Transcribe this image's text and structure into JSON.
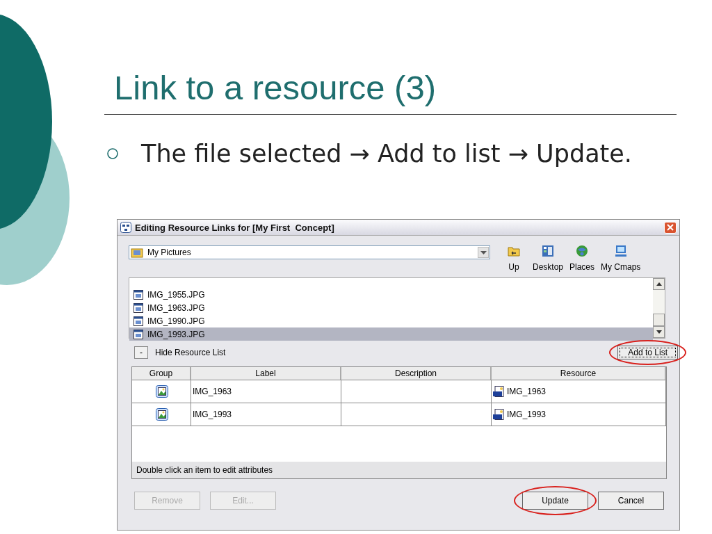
{
  "slide": {
    "title": "Link to a resource (3)",
    "bullets": [
      {
        "text": "The file selected → Add to list → Update."
      }
    ]
  },
  "dialog": {
    "title": "Editing Resource Links for [My First  Concept]",
    "location": {
      "value": "My Pictures"
    },
    "nav_buttons": [
      {
        "label": "Up",
        "kind": "up"
      },
      {
        "label": "Desktop",
        "kind": "desktop"
      },
      {
        "label": "Places",
        "kind": "places"
      },
      {
        "label": "My Cmaps",
        "kind": "cmaps"
      }
    ],
    "files": [
      {
        "name": "IMG_1955.JPG",
        "selected": false
      },
      {
        "name": "IMG_1963.JPG",
        "selected": false
      },
      {
        "name": "IMG_1990.JPG",
        "selected": false
      },
      {
        "name": "IMG_1993.JPG",
        "selected": true
      }
    ],
    "toggle": {
      "symbol": "-",
      "label": "Hide Resource List"
    },
    "add_button": {
      "label": "Add to List",
      "focused": true,
      "circled": true
    },
    "table": {
      "columns": [
        "Group",
        "Label",
        "Description",
        "Resource"
      ],
      "rows": [
        {
          "label": "IMG_1963",
          "resource": "IMG_1963"
        },
        {
          "label": "IMG_1993",
          "resource": "IMG_1993"
        }
      ]
    },
    "hint": "Double click an item to edit attributes",
    "buttons": [
      {
        "label": "Remove",
        "disabled": true,
        "circled": false
      },
      {
        "label": "Edit...",
        "disabled": true,
        "circled": false
      },
      {
        "label": "Update",
        "disabled": false,
        "circled": true
      },
      {
        "label": "Cancel",
        "disabled": false,
        "circled": false
      }
    ]
  }
}
